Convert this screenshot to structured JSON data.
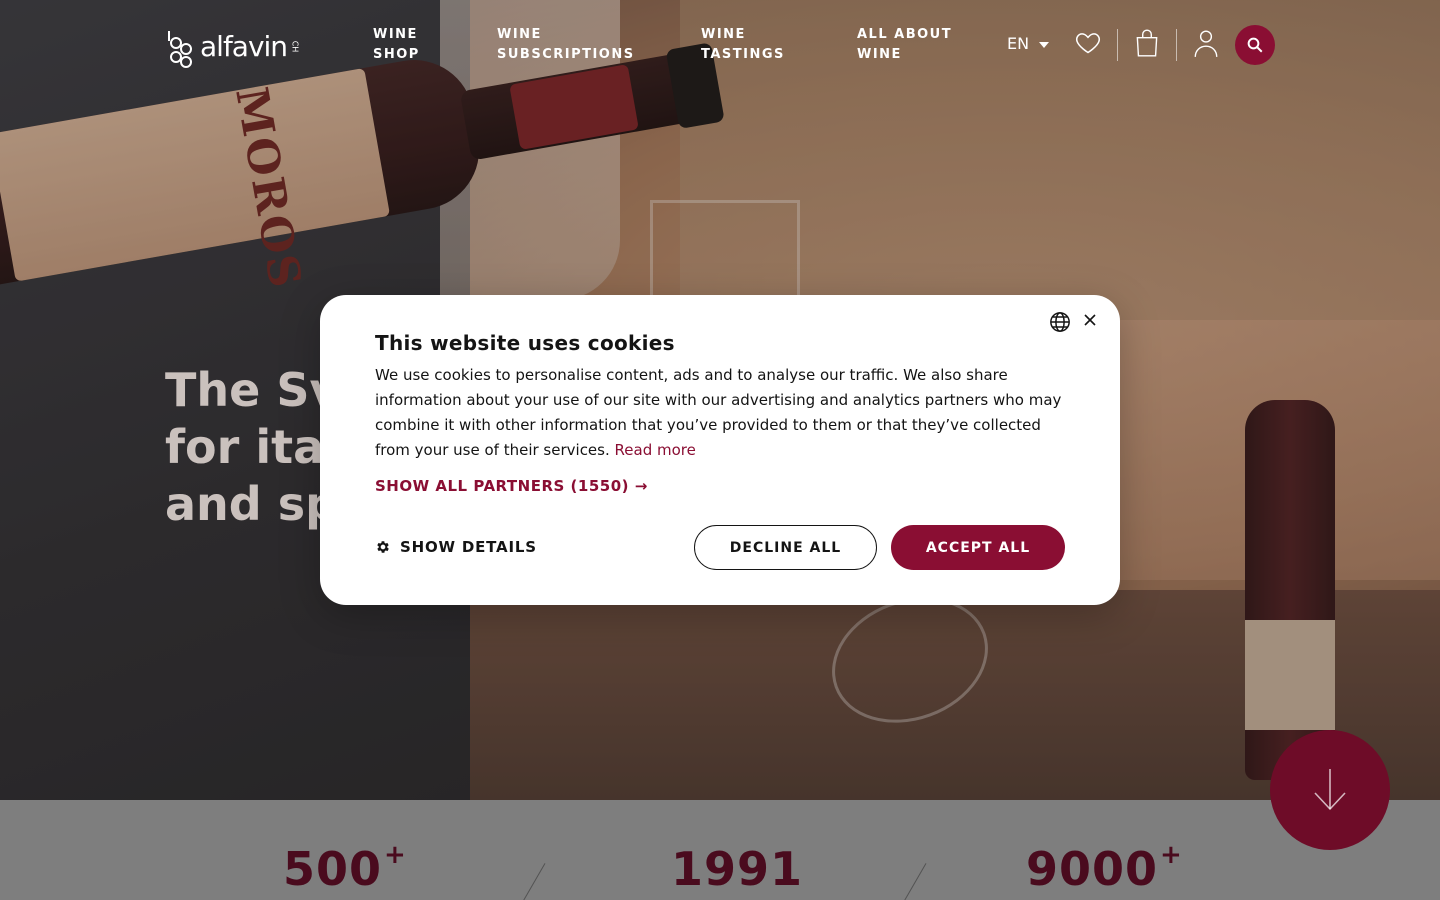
{
  "brand": {
    "logo_text": "alfavin",
    "logo_sup": "CH",
    "accent": "#8a0e33"
  },
  "nav": {
    "items": [
      {
        "label_line1": "WINE",
        "label_line2": "SHOP"
      },
      {
        "label_line1": "WINE",
        "label_line2": "SUBSCRIPTIONS"
      },
      {
        "label_line1": "WINE",
        "label_line2": "TASTINGS"
      },
      {
        "label_line1": "ALL ABOUT",
        "label_line2": "WINE"
      }
    ],
    "language": "EN",
    "icons": [
      "heart-icon",
      "shopping-bag-icon",
      "user-icon",
      "search-icon"
    ]
  },
  "hero": {
    "bottle_label": "MOROS",
    "title_lines": [
      "The Sv",
      "for ital",
      "and sp"
    ]
  },
  "stats": [
    {
      "value": "500",
      "suffix": "+"
    },
    {
      "value": "1991",
      "suffix": ""
    },
    {
      "value": "9000",
      "suffix": "+"
    }
  ],
  "cookie": {
    "title": "This website uses cookies",
    "body": "We use cookies to personalise content, ads and to analyse our traffic. We also share information about your use of our site with our advertising and analytics partners who may combine it with other information that you’ve provided to them or that they’ve collected from your use of their services.",
    "read_more": "Read more",
    "partners": "SHOW ALL PARTNERS (1550) →",
    "details": "SHOW DETAILS",
    "decline": "DECLINE ALL",
    "accept": "ACCEPT ALL"
  }
}
